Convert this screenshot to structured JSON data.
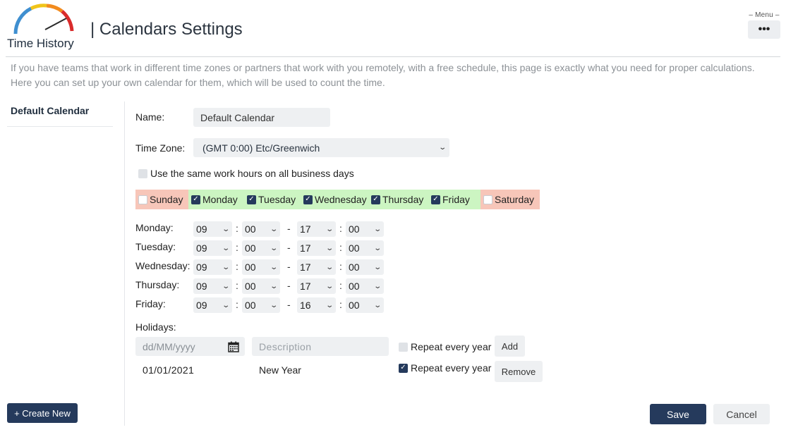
{
  "header": {
    "logo_text": "Time History",
    "title": "| Calendars Settings",
    "menu_label": "– Menu –",
    "menu_button": "•••"
  },
  "intro": "If you have teams that work in different time zones or partners that work with you remotely, with a free schedule, this page is exactly what you need for proper calculations. Here you can set up your own calendar for them, which will be used to count the time.",
  "sidebar": {
    "items": [
      {
        "label": "Default Calendar"
      }
    ],
    "create_button": "+ Create New"
  },
  "form": {
    "name_label": "Name:",
    "name_value": "Default Calendar",
    "timezone_label": "Time Zone:",
    "timezone_value": "(GMT 0:00) Etc/Greenwich",
    "same_hours_label": "Use the same work hours on all business days",
    "same_hours_checked": false,
    "days": [
      {
        "label": "Sunday",
        "checked": false
      },
      {
        "label": "Monday",
        "checked": true
      },
      {
        "label": "Tuesday",
        "checked": true
      },
      {
        "label": "Wednesday",
        "checked": true
      },
      {
        "label": "Thursday",
        "checked": true
      },
      {
        "label": "Friday",
        "checked": true
      },
      {
        "label": "Saturday",
        "checked": false
      }
    ],
    "hours": [
      {
        "day": "Monday:",
        "start_h": "09",
        "start_m": "00",
        "end_h": "17",
        "end_m": "00"
      },
      {
        "day": "Tuesday:",
        "start_h": "09",
        "start_m": "00",
        "end_h": "17",
        "end_m": "00"
      },
      {
        "day": "Wednesday:",
        "start_h": "09",
        "start_m": "00",
        "end_h": "17",
        "end_m": "00"
      },
      {
        "day": "Thursday:",
        "start_h": "09",
        "start_m": "00",
        "end_h": "17",
        "end_m": "00"
      },
      {
        "day": "Friday:",
        "start_h": "09",
        "start_m": "00",
        "end_h": "16",
        "end_m": "00"
      }
    ],
    "separators": {
      "colon": ":",
      "dash": "-"
    },
    "holidays_label": "Holidays:",
    "date_placeholder": "dd/MM/yyyy",
    "description_placeholder": "Description",
    "repeat_label": "Repeat every year",
    "add_button": "Add",
    "holidays": [
      {
        "date": "01/01/2021",
        "description": "New Year",
        "repeat": true,
        "remove_label": "Remove"
      }
    ],
    "save_button": "Save",
    "cancel_button": "Cancel"
  },
  "colors": {
    "primary": "#253a5c",
    "day_on": "#ccf5c2",
    "day_off": "#f7c6b9",
    "field_bg": "#eef0f2"
  },
  "icons": {
    "calendar": "calendar-icon",
    "chevron": "chevron-down-icon",
    "check": "check-icon"
  }
}
